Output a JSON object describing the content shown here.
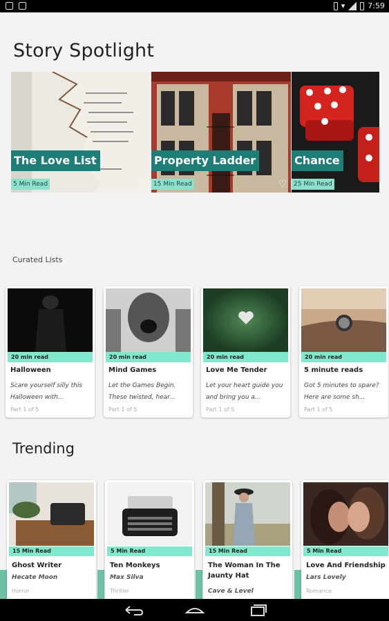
{
  "status_bar": {
    "time": "7:59"
  },
  "spotlight": {
    "heading": "Story Spotlight",
    "items": [
      {
        "title": "The Love List",
        "read_time": "5 Min Read"
      },
      {
        "title": "Property Ladder",
        "read_time": "15 Min Read"
      },
      {
        "title": "Chance",
        "read_time": "25 Min Read"
      }
    ]
  },
  "curated": {
    "heading": "Curated Lists",
    "items": [
      {
        "read_time": "20 min read",
        "title": "Halloween",
        "desc1": "Scare yourself silly this",
        "desc2": "Halloween with...",
        "part": "Part 1 of 5"
      },
      {
        "read_time": "20 min read",
        "title": "Mind Games",
        "desc1": "Let the Games Begin.",
        "desc2": "These twisted, hear...",
        "part": "Part 1 of 5"
      },
      {
        "read_time": "20 min read",
        "title": "Love Me Tender",
        "desc1": "Let your heart guide you",
        "desc2": "and bring you a...",
        "part": "Part 1 of 5"
      },
      {
        "read_time": "20 min read",
        "title": "5 minute reads",
        "desc1": "Got 5 minutes to spare?",
        "desc2": "Here are some sh...",
        "part": "Part 1 of 5"
      }
    ]
  },
  "trending": {
    "heading": "Trending",
    "items": [
      {
        "read_time": "15 Min Read",
        "title1": "Ghost Writer",
        "title2": "",
        "author": "Hecate Moon",
        "genre": "Horror"
      },
      {
        "read_time": "5 Min Read",
        "title1": "Ten Monkeys",
        "title2": "",
        "author": "Max Silva",
        "genre": "Thriller"
      },
      {
        "read_time": "15 Min Read",
        "title1": "The Woman In The",
        "title2": "Jaunty Hat",
        "author": "Cave & Level",
        "genre": ""
      },
      {
        "read_time": "5 Min Read",
        "title1": "Love And Friendship",
        "title2": "",
        "author": "Lars Lovely",
        "genre": "Romance"
      }
    ]
  },
  "icons": {
    "heart": "heart-icon",
    "back": "back-icon",
    "home": "home-icon",
    "recents": "recents-icon"
  },
  "colors": {
    "accent_dark": "#1f7d78",
    "accent_light": "#7fe8cd"
  }
}
